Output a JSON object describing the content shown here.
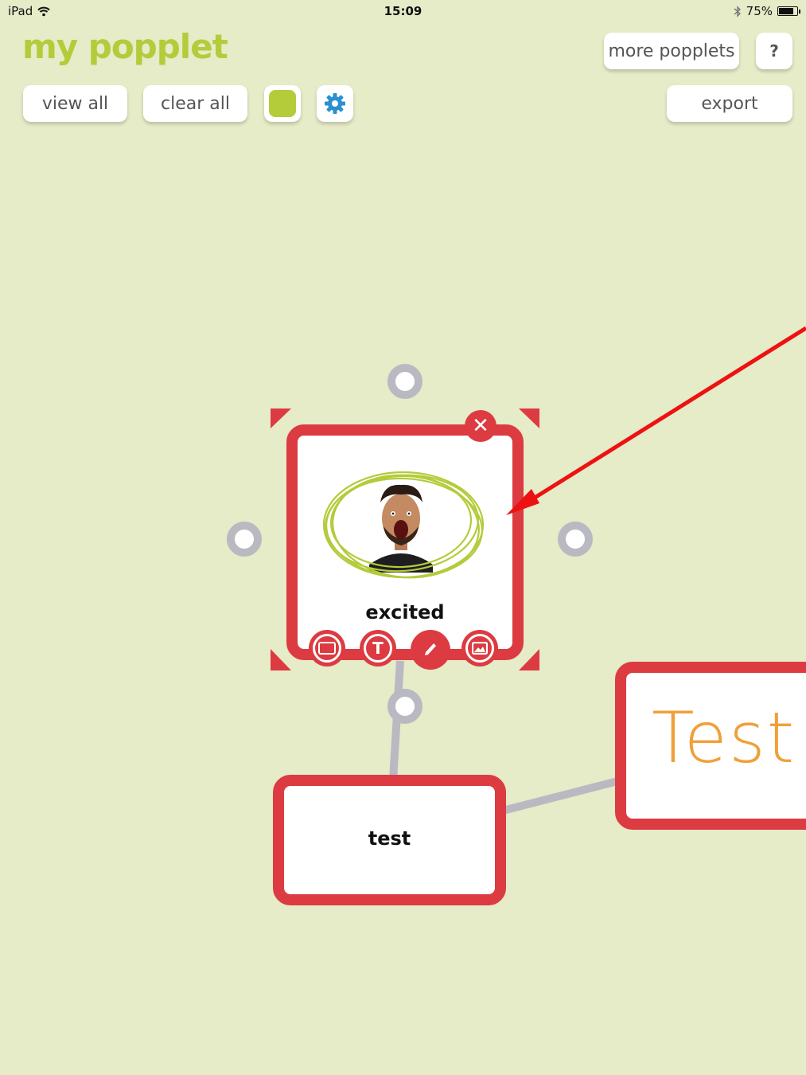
{
  "status_bar": {
    "device": "iPad",
    "time": "15:09",
    "battery": "75%",
    "battery_level": 0.75
  },
  "header": {
    "title": "my popplet",
    "more_popplets_label": "more popplets",
    "help_label": "?",
    "view_all_label": "view all",
    "clear_all_label": "clear all",
    "export_label": "export",
    "color_swatch": "#b4cb3a",
    "settings_icon": "gear-icon"
  },
  "canvas": {
    "popples": [
      {
        "label": "excited",
        "image": "excited-face-photo",
        "drawing_color": "#b4cb3a",
        "selected": true
      },
      {
        "label": "test"
      },
      {
        "handwritten_text": "Test",
        "ink_color": "#f0a03a"
      }
    ],
    "toolbar_icons": [
      "frame-icon",
      "text-icon",
      "pencil-icon",
      "image-icon"
    ],
    "accent_color": "#dc3b41",
    "connector_color": "#b9b9c2",
    "annotation_arrow_color": "#ee1111"
  }
}
